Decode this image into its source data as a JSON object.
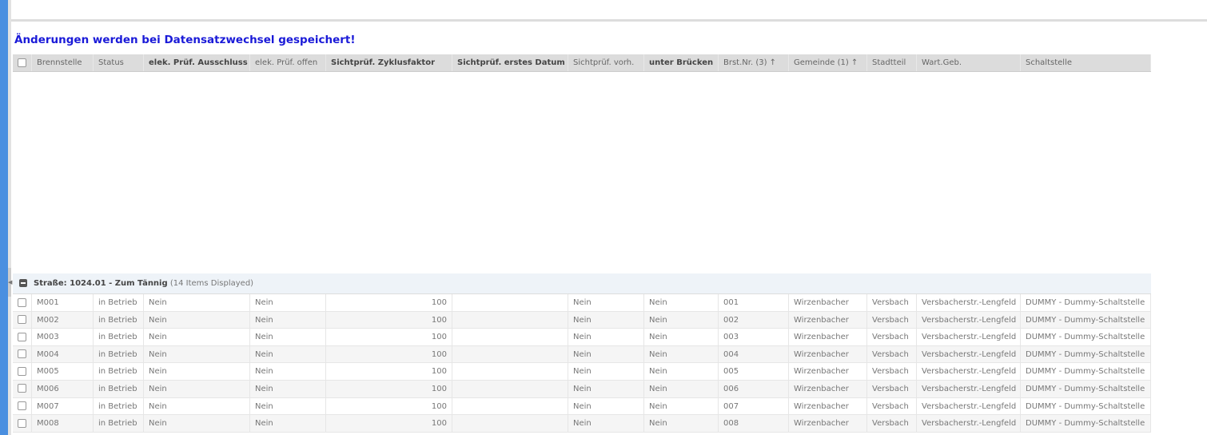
{
  "notice": "Änderungen werden bei Datensatzwechsel gespeichert!",
  "columns": [
    {
      "label": "Brennstelle",
      "bold": false
    },
    {
      "label": "Status",
      "bold": false
    },
    {
      "label": "elek. Prüf. Ausschluss",
      "bold": true
    },
    {
      "label": "elek. Prüf. offen",
      "bold": false
    },
    {
      "label": "Sichtprüf. Zyklusfaktor",
      "bold": true
    },
    {
      "label": "Sichtprüf. erstes Datum",
      "bold": true
    },
    {
      "label": "Sichtprüf. vorh.",
      "bold": false
    },
    {
      "label": "unter Brücken",
      "bold": true
    },
    {
      "label": "Brst.Nr. (3) ↑",
      "bold": false
    },
    {
      "label": "Gemeinde (1) ↑",
      "bold": false
    },
    {
      "label": "Stadtteil",
      "bold": false
    },
    {
      "label": "Wart.Geb.",
      "bold": false
    },
    {
      "label": "Schaltstelle",
      "bold": false
    }
  ],
  "group": {
    "title": "Straße: 1024.01 - Zum Tännig",
    "count": "(14 Items Displayed)"
  },
  "rows": [
    [
      "M001",
      "in Betrieb",
      "Nein",
      "Nein",
      "100",
      "",
      "Nein",
      "Nein",
      "001",
      "Wirzenbacher",
      "Versbach",
      "Versbacherstr.-Lengfeld",
      "DUMMY - Dummy-Schaltstelle"
    ],
    [
      "M002",
      "in Betrieb",
      "Nein",
      "Nein",
      "100",
      "",
      "Nein",
      "Nein",
      "002",
      "Wirzenbacher",
      "Versbach",
      "Versbacherstr.-Lengfeld",
      "DUMMY - Dummy-Schaltstelle"
    ],
    [
      "M003",
      "in Betrieb",
      "Nein",
      "Nein",
      "100",
      "",
      "Nein",
      "Nein",
      "003",
      "Wirzenbacher",
      "Versbach",
      "Versbacherstr.-Lengfeld",
      "DUMMY - Dummy-Schaltstelle"
    ],
    [
      "M004",
      "in Betrieb",
      "Nein",
      "Nein",
      "100",
      "",
      "Nein",
      "Nein",
      "004",
      "Wirzenbacher",
      "Versbach",
      "Versbacherstr.-Lengfeld",
      "DUMMY - Dummy-Schaltstelle"
    ],
    [
      "M005",
      "in Betrieb",
      "Nein",
      "Nein",
      "100",
      "",
      "Nein",
      "Nein",
      "005",
      "Wirzenbacher",
      "Versbach",
      "Versbacherstr.-Lengfeld",
      "DUMMY - Dummy-Schaltstelle"
    ],
    [
      "M006",
      "in Betrieb",
      "Nein",
      "Nein",
      "100",
      "",
      "Nein",
      "Nein",
      "006",
      "Wirzenbacher",
      "Versbach",
      "Versbacherstr.-Lengfeld",
      "DUMMY - Dummy-Schaltstelle"
    ],
    [
      "M007",
      "in Betrieb",
      "Nein",
      "Nein",
      "100",
      "",
      "Nein",
      "Nein",
      "007",
      "Wirzenbacher",
      "Versbach",
      "Versbacherstr.-Lengfeld",
      "DUMMY - Dummy-Schaltstelle"
    ],
    [
      "M008",
      "in Betrieb",
      "Nein",
      "Nein",
      "100",
      "",
      "Nein",
      "Nein",
      "008",
      "Wirzenbacher",
      "Versbach",
      "Versbacherstr.-Lengfeld",
      "DUMMY - Dummy-Schaltstelle"
    ]
  ]
}
